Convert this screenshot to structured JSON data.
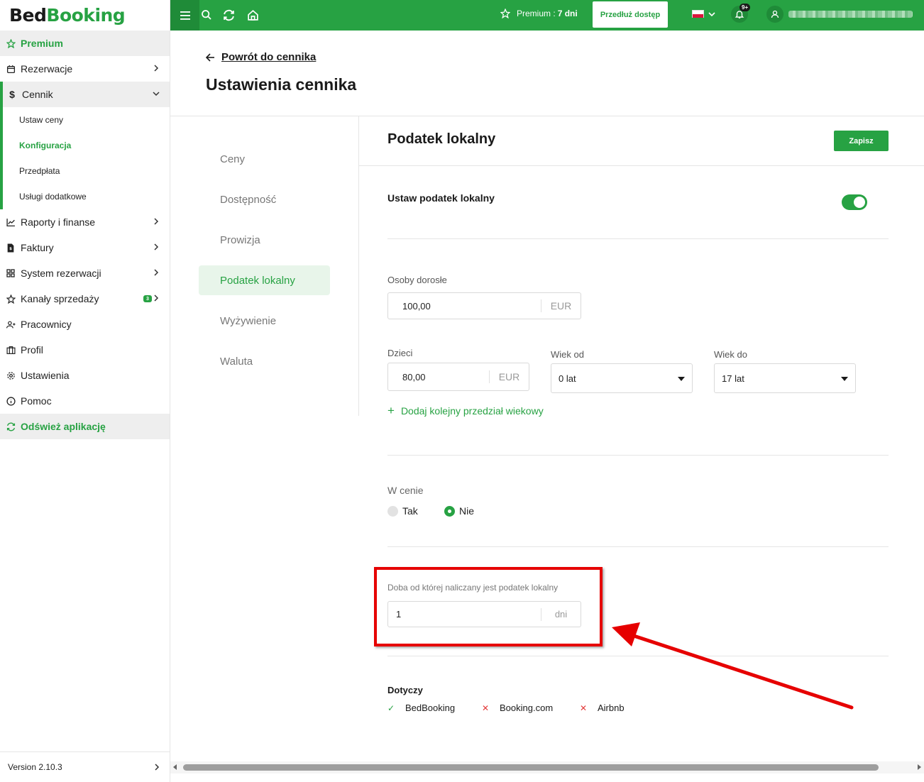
{
  "app": {
    "logo_bed": "Bed",
    "logo_booking": "Booking",
    "version": "Version 2.10.3"
  },
  "sidebar": {
    "premium": "Premium",
    "rezerwacje": "Rezerwacje",
    "cennik": "Cennik",
    "cennik_sub": [
      "Ustaw ceny",
      "Konfiguracja",
      "Przedpłata",
      "Usługi dodatkowe"
    ],
    "raporty": "Raporty i finanse",
    "faktury": "Faktury",
    "system": "System rezerwacji",
    "kanaly": "Kanały sprzedaży",
    "kanaly_badge": "3",
    "pracownicy": "Pracownicy",
    "profil": "Profil",
    "ustawienia": "Ustawienia",
    "pomoc": "Pomoc",
    "odswiez": "Odśwież aplikację"
  },
  "topbar": {
    "premium_label": "Premium :",
    "premium_days": "7 dni",
    "extend_button": "Przedłuż dostęp",
    "notifications": "9+",
    "colors": {
      "brand": "#27a243",
      "brand_dark": "#1f8b38"
    }
  },
  "page": {
    "back_link": "Powrót do cennika",
    "title": "Ustawienia cennika"
  },
  "settings_nav": {
    "items": [
      "Ceny",
      "Dostępność",
      "Prowizja",
      "Podatek lokalny",
      "Wyżywienie",
      "Waluta"
    ],
    "selected": "Podatek lokalny"
  },
  "content": {
    "section_title": "Podatek lokalny",
    "save_button": "Zapisz",
    "set_tax_label": "Ustaw podatek lokalny",
    "set_tax_enabled": true,
    "adults": {
      "label": "Osoby dorosłe",
      "value": "100,00",
      "unit": "EUR"
    },
    "children": {
      "label": "Dzieci",
      "value": "80,00",
      "unit": "EUR",
      "age_from_label": "Wiek od",
      "age_from_value": "0 lat",
      "age_to_label": "Wiek do",
      "age_to_value": "17 lat"
    },
    "add_age_range": "Dodaj kolejny przedział wiekowy",
    "in_price": {
      "label": "W cenie",
      "options": [
        "Tak",
        "Nie"
      ],
      "selected": "Nie"
    },
    "day_from": {
      "label": "Doba od której naliczany jest podatek lokalny",
      "value": "1",
      "unit": "dni"
    },
    "applies": {
      "label": "Dotyczy",
      "items": [
        {
          "name": "BedBooking",
          "enabled": true
        },
        {
          "name": "Booking.com",
          "enabled": false
        },
        {
          "name": "Airbnb",
          "enabled": false
        }
      ]
    }
  }
}
